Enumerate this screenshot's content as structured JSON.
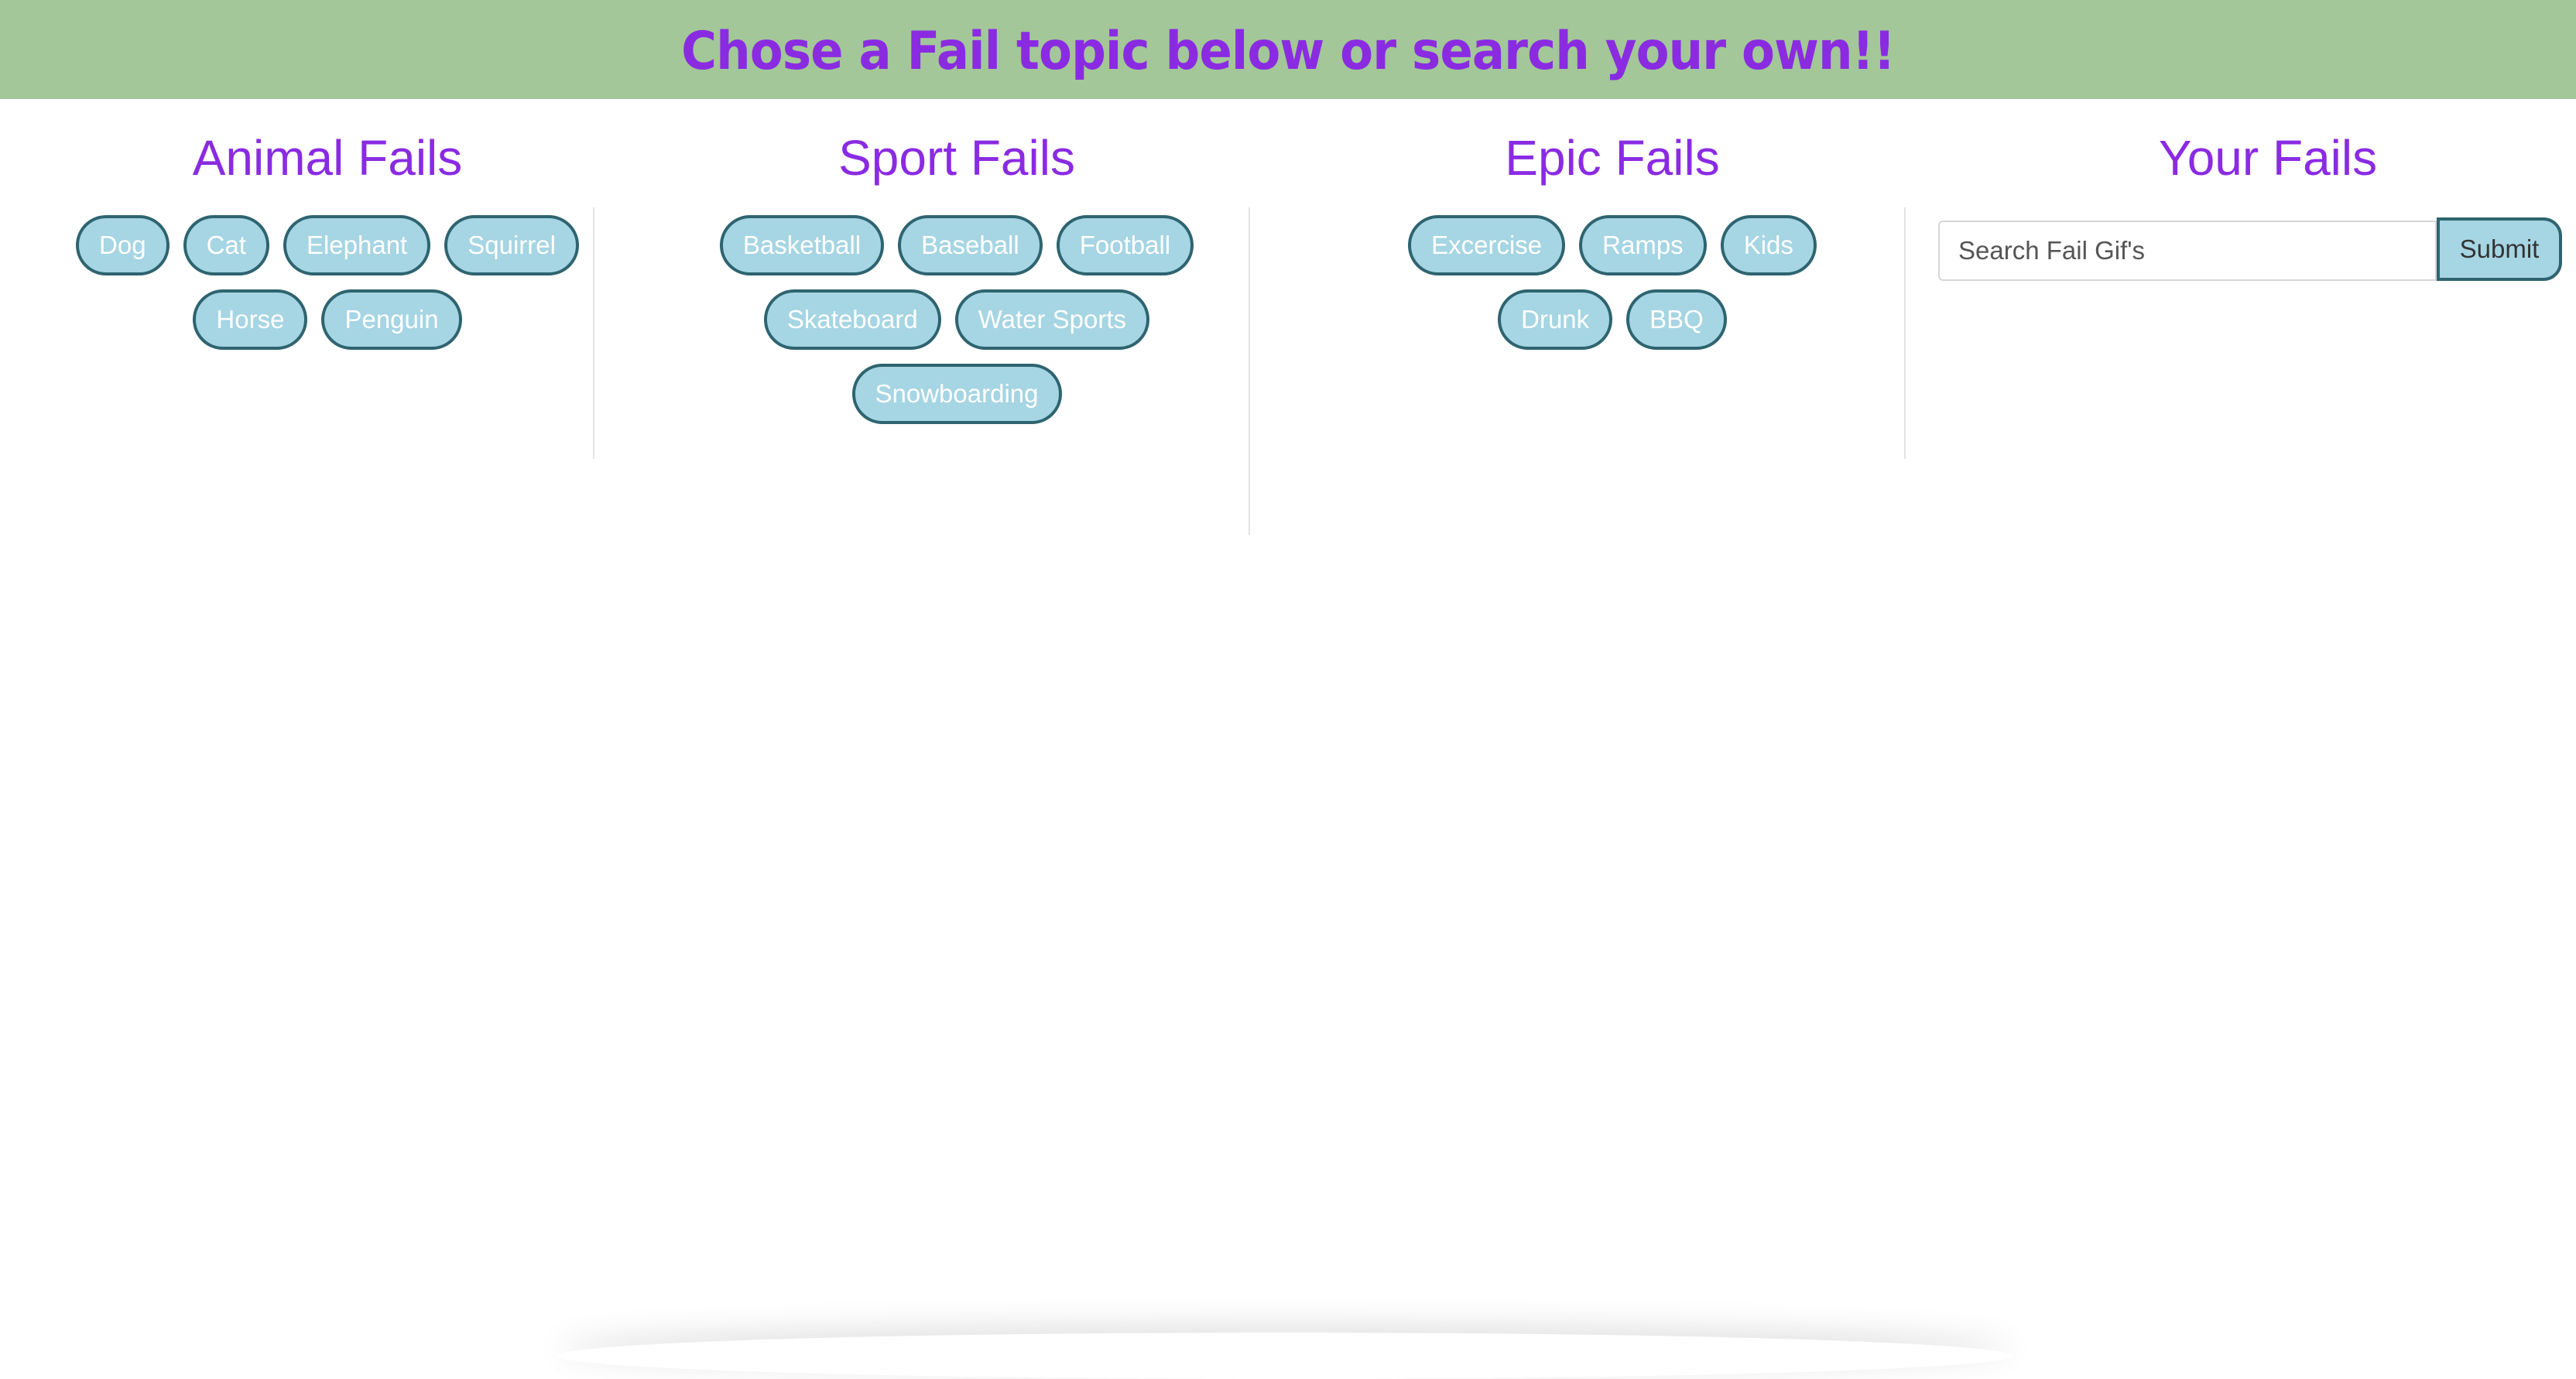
{
  "header": {
    "title": "Chose a Fail topic below or search your own!!"
  },
  "columns": [
    {
      "heading": "Animal Fails",
      "buttons": [
        "Dog",
        "Cat",
        "Elephant",
        "Squirrel",
        "Horse",
        "Penguin"
      ]
    },
    {
      "heading": "Sport Fails",
      "buttons": [
        "Basketball",
        "Baseball",
        "Football",
        "Skateboard",
        "Water Sports",
        "Snowboarding"
      ]
    },
    {
      "heading": "Epic Fails",
      "buttons": [
        "Excercise",
        "Ramps",
        "Kids",
        "Drunk",
        "BBQ"
      ]
    },
    {
      "heading": "Your Fails",
      "search": {
        "placeholder": "Search Fail Gif's",
        "value": "",
        "submit_label": "Submit"
      }
    }
  ],
  "colors": {
    "banner_background": "#a3c798",
    "heading_text": "#8a2be2",
    "button_fill": "#a6d5e3",
    "button_border": "#2e6470",
    "button_text": "#ffffff"
  }
}
